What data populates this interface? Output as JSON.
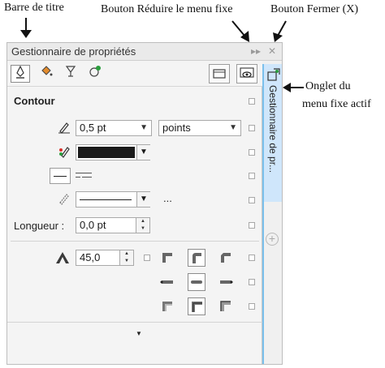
{
  "annotations": {
    "title_bar": "Barre de titre",
    "collapse_button": "Bouton Réduire le menu fixe",
    "close_button": "Bouton Fermer (X)",
    "docked_tab_line1": "Onglet du",
    "docked_tab_line2": "menu fixe actif"
  },
  "docker": {
    "title": "Gestionnaire de propriétés",
    "tab_label": "Gestionnaire de pr...",
    "collapse_glyph": "▸▸",
    "close_glyph": "✕",
    "add_glyph": "+"
  },
  "toolbar": {
    "icons": [
      "outline-pen-icon",
      "fill-bucket-icon",
      "transparency-glass-icon",
      "object-effect-icon"
    ],
    "active_index": 0
  },
  "contour": {
    "section_title": "Contour",
    "width_value": "0,5 pt",
    "units_value": "points",
    "color_value": "#1a1a1a",
    "more_glyph": "...",
    "length_label": "Longueur :",
    "length_value": "0,0 pt",
    "miter_value": "45,0"
  },
  "colors": {
    "accent_blue": "#7bc0ec",
    "tab_bg": "#cfe6fb"
  }
}
